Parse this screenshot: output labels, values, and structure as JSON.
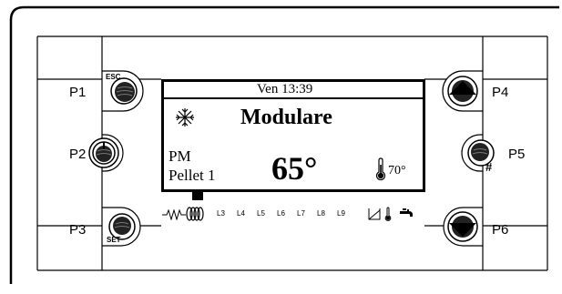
{
  "buttons": {
    "p1": {
      "label": "P1",
      "tag": "ESC"
    },
    "p2": {
      "label": "P2"
    },
    "p3": {
      "label": "P3",
      "tag": "SET"
    },
    "p4": {
      "label": "P4"
    },
    "p5": {
      "label": "P5",
      "tag": "#"
    },
    "p6": {
      "label": "P6"
    }
  },
  "display": {
    "datetime": "Ven 13:39",
    "mode": "Modulare",
    "mode_code": "PM",
    "fuel": "Pellet 1",
    "temperature": "65°",
    "setpoint": "70°",
    "indicators": [
      "L3",
      "L4",
      "L5",
      "L6",
      "L7",
      "L8",
      "L9"
    ]
  },
  "icons": {
    "mode_icon": "snowflake-icon",
    "thermometer": "thermometer-icon",
    "resistor": "resistor-icon",
    "coil": "coil-icon",
    "tank": "tank-icon",
    "tap": "tap-icon"
  }
}
